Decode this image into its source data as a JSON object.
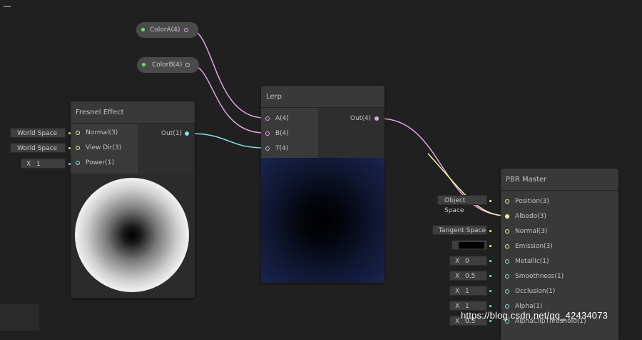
{
  "colors": {
    "background": "#202020",
    "port_color4": "#e0a4e0",
    "port_vector3": "#f3f3a0",
    "port_vector1": "#84e4e7",
    "port_in_green": "#7cd87c"
  },
  "properties": {
    "colorA": "ColorA(4)",
    "colorB": "ColorB(4)"
  },
  "fresnel": {
    "title": "Fresnel Effect",
    "inputs": [
      "Normal(3)",
      "View Dir(3)",
      "Power(1)"
    ],
    "output": "Out(1)",
    "fields": {
      "normal": "World Space",
      "view_dir": "World Space",
      "power_x": "X",
      "power_value": "1"
    }
  },
  "lerp": {
    "title": "Lerp",
    "inputs": [
      "A(4)",
      "B(4)",
      "T(4)"
    ],
    "output": "Out(4)"
  },
  "pbr": {
    "title": "PBR Master",
    "inputs": [
      "Position(3)",
      "Albedo(3)",
      "Normal(3)",
      "Emission(3)",
      "Metallic(1)",
      "Smoothness(1)",
      "Occlusion(1)",
      "Alpha(1)",
      "AlphaClipThreshold(1)"
    ],
    "fields": {
      "position": "Object Space",
      "normal": "Tangent Space",
      "x_label": "X",
      "metallic": "0",
      "smoothness": "0.5",
      "occlusion": "1",
      "alpha": "1",
      "alpha_clip": "0.5"
    }
  },
  "watermark": "https://blog.csdn.net/qq_42434073"
}
